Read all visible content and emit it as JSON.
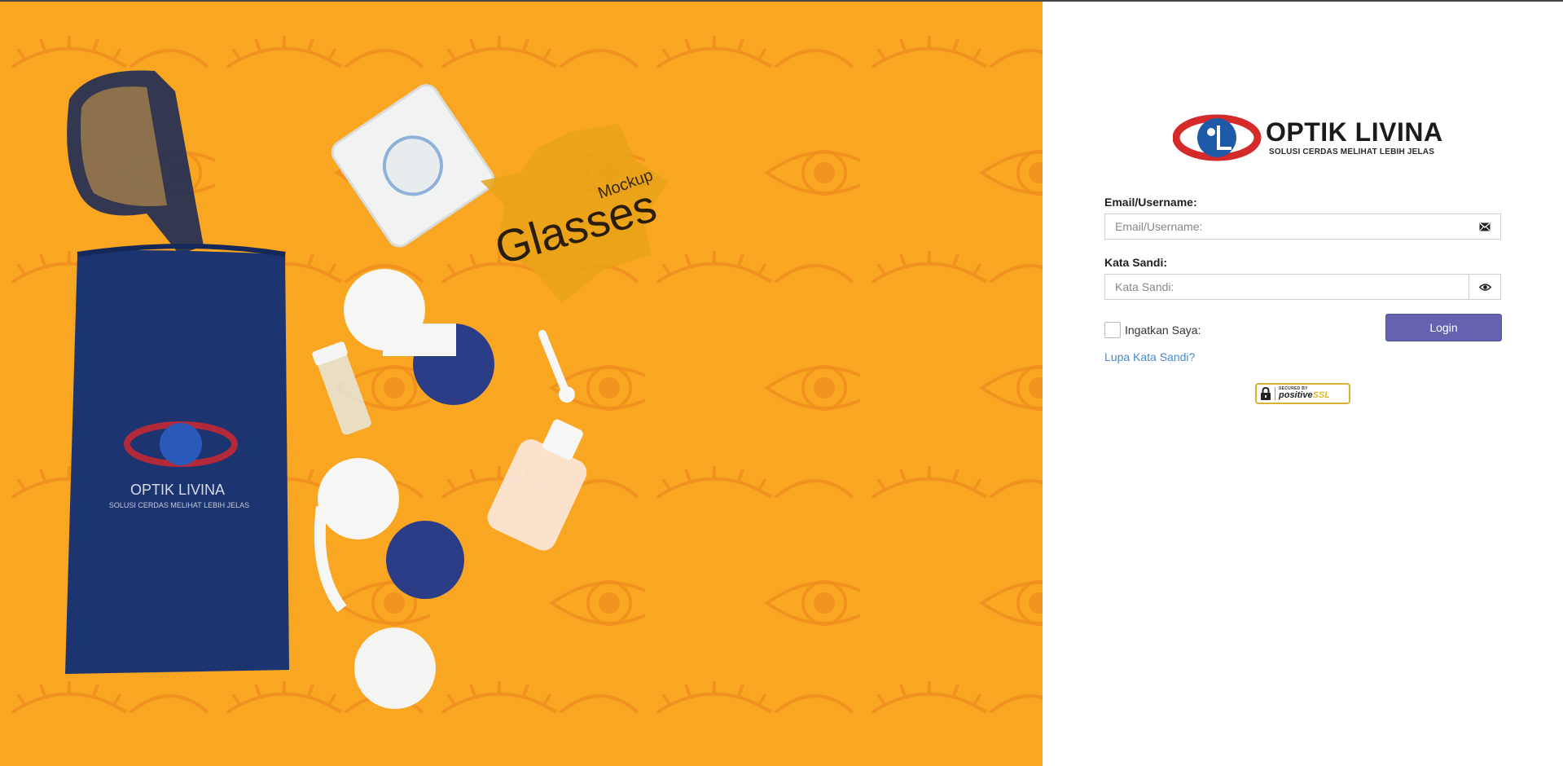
{
  "brand": {
    "name": "OPTIK LIVINA",
    "tagline": "SOLUSI CERDAS MELIHAT LEBIH JELAS"
  },
  "hero": {
    "badge_top": "Mockup",
    "badge_main": "Glasses",
    "case_brand": "OPTIK LIVINA",
    "case_tagline": "SOLUSI CERDAS MELIHAT LEBIH JELAS"
  },
  "login": {
    "email_label": "Email/Username:",
    "email_placeholder": "Email/Username:",
    "password_label": "Kata Sandi:",
    "password_placeholder": "Kata Sandi:",
    "remember_label": "Ingatkan Saya:",
    "submit_label": "Login",
    "forgot_link": "Lupa Kata Sandi?"
  },
  "ssl_badge": {
    "secured_by": "SECURED BY",
    "brand_a": "positive",
    "brand_b": "SSL"
  },
  "colors": {
    "hero_bg": "#f9a623",
    "button": "#6563b0",
    "link": "#4a89c8",
    "brand_red": "#d42a2a",
    "brand_blue": "#1f5aa8",
    "case_navy": "#1c3470"
  },
  "icons": {
    "email_addon": "envelope-icon",
    "password_addon": "eye-icon",
    "ssl_lock": "lock-icon"
  }
}
